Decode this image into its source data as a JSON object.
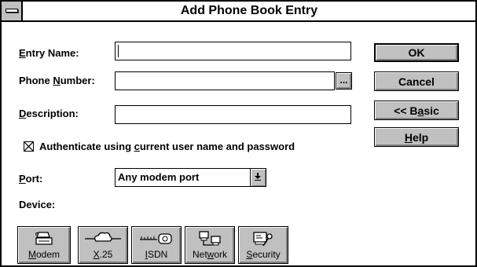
{
  "window": {
    "title": "Add Phone Book Entry"
  },
  "form": {
    "entry_name": {
      "label_ul": "E",
      "label_rest": "ntry Name:",
      "value": ""
    },
    "phone_number": {
      "label_pre": "Phone ",
      "label_ul": "N",
      "label_rest": "umber:",
      "value": "",
      "browse_label": "..."
    },
    "description": {
      "label_ul": "D",
      "label_rest": "escription:",
      "value": ""
    },
    "authenticate": {
      "label_pre": "Authenticate using ",
      "label_ul": "c",
      "label_rest": "urrent user name and password",
      "checked": true
    },
    "port": {
      "label_ul": "P",
      "label_rest": "ort:",
      "value": "Any modem port"
    },
    "device": {
      "label": "Device:"
    }
  },
  "buttons": {
    "ok": "OK",
    "cancel": "Cancel",
    "basic_pre": "<< B",
    "basic_ul": "a",
    "basic_rest": "sic",
    "help_ul": "H",
    "help_rest": "elp"
  },
  "device_buttons": [
    {
      "ul": "M",
      "rest": "odem",
      "icon": "modem-icon"
    },
    {
      "ul": "X",
      "rest": ".25",
      "icon": "x25-cloud-icon"
    },
    {
      "ul": "I",
      "rest": "SDN",
      "icon": "isdn-icon"
    },
    {
      "pre": "Net",
      "ul": "w",
      "rest": "ork",
      "icon": "network-icon"
    },
    {
      "ul": "S",
      "rest": "ecurity",
      "icon": "security-icon"
    }
  ]
}
